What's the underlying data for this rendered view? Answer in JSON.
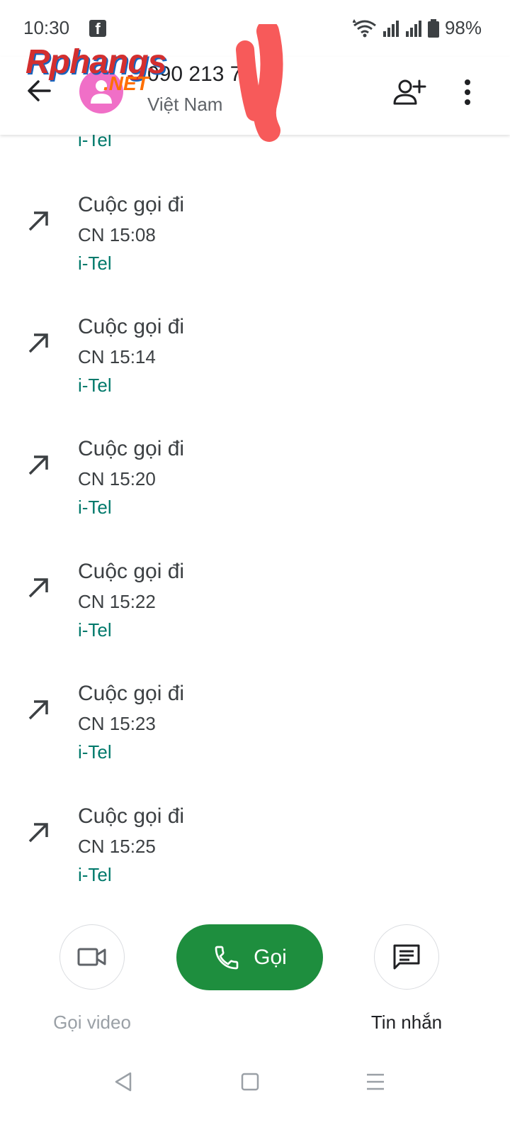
{
  "status_bar": {
    "time": "10:30",
    "battery": "98%"
  },
  "header": {
    "number": "090 213 7",
    "country": "Việt Nam",
    "watermark": "Rphangs",
    "watermark_suffix": ".NET"
  },
  "calls": {
    "partial_sim": "i-Tel",
    "items": [
      {
        "type": "Cuộc gọi đi",
        "time": "CN 15:08",
        "sim": "i-Tel"
      },
      {
        "type": "Cuộc gọi đi",
        "time": "CN 15:14",
        "sim": "i-Tel"
      },
      {
        "type": "Cuộc gọi đi",
        "time": "CN 15:20",
        "sim": "i-Tel"
      },
      {
        "type": "Cuộc gọi đi",
        "time": "CN 15:22",
        "sim": "i-Tel"
      },
      {
        "type": "Cuộc gọi đi",
        "time": "CN 15:23",
        "sim": "i-Tel"
      },
      {
        "type": "Cuộc gọi đi",
        "time": "CN 15:25",
        "sim": "i-Tel"
      }
    ]
  },
  "actions": {
    "video_label": "Gọi video",
    "call_label": "Gọi",
    "message_label": "Tin nhắn"
  },
  "colors": {
    "accent_green": "#1e8e3e",
    "sim_teal": "#00796b",
    "avatar_pink": "#f06fc7"
  }
}
